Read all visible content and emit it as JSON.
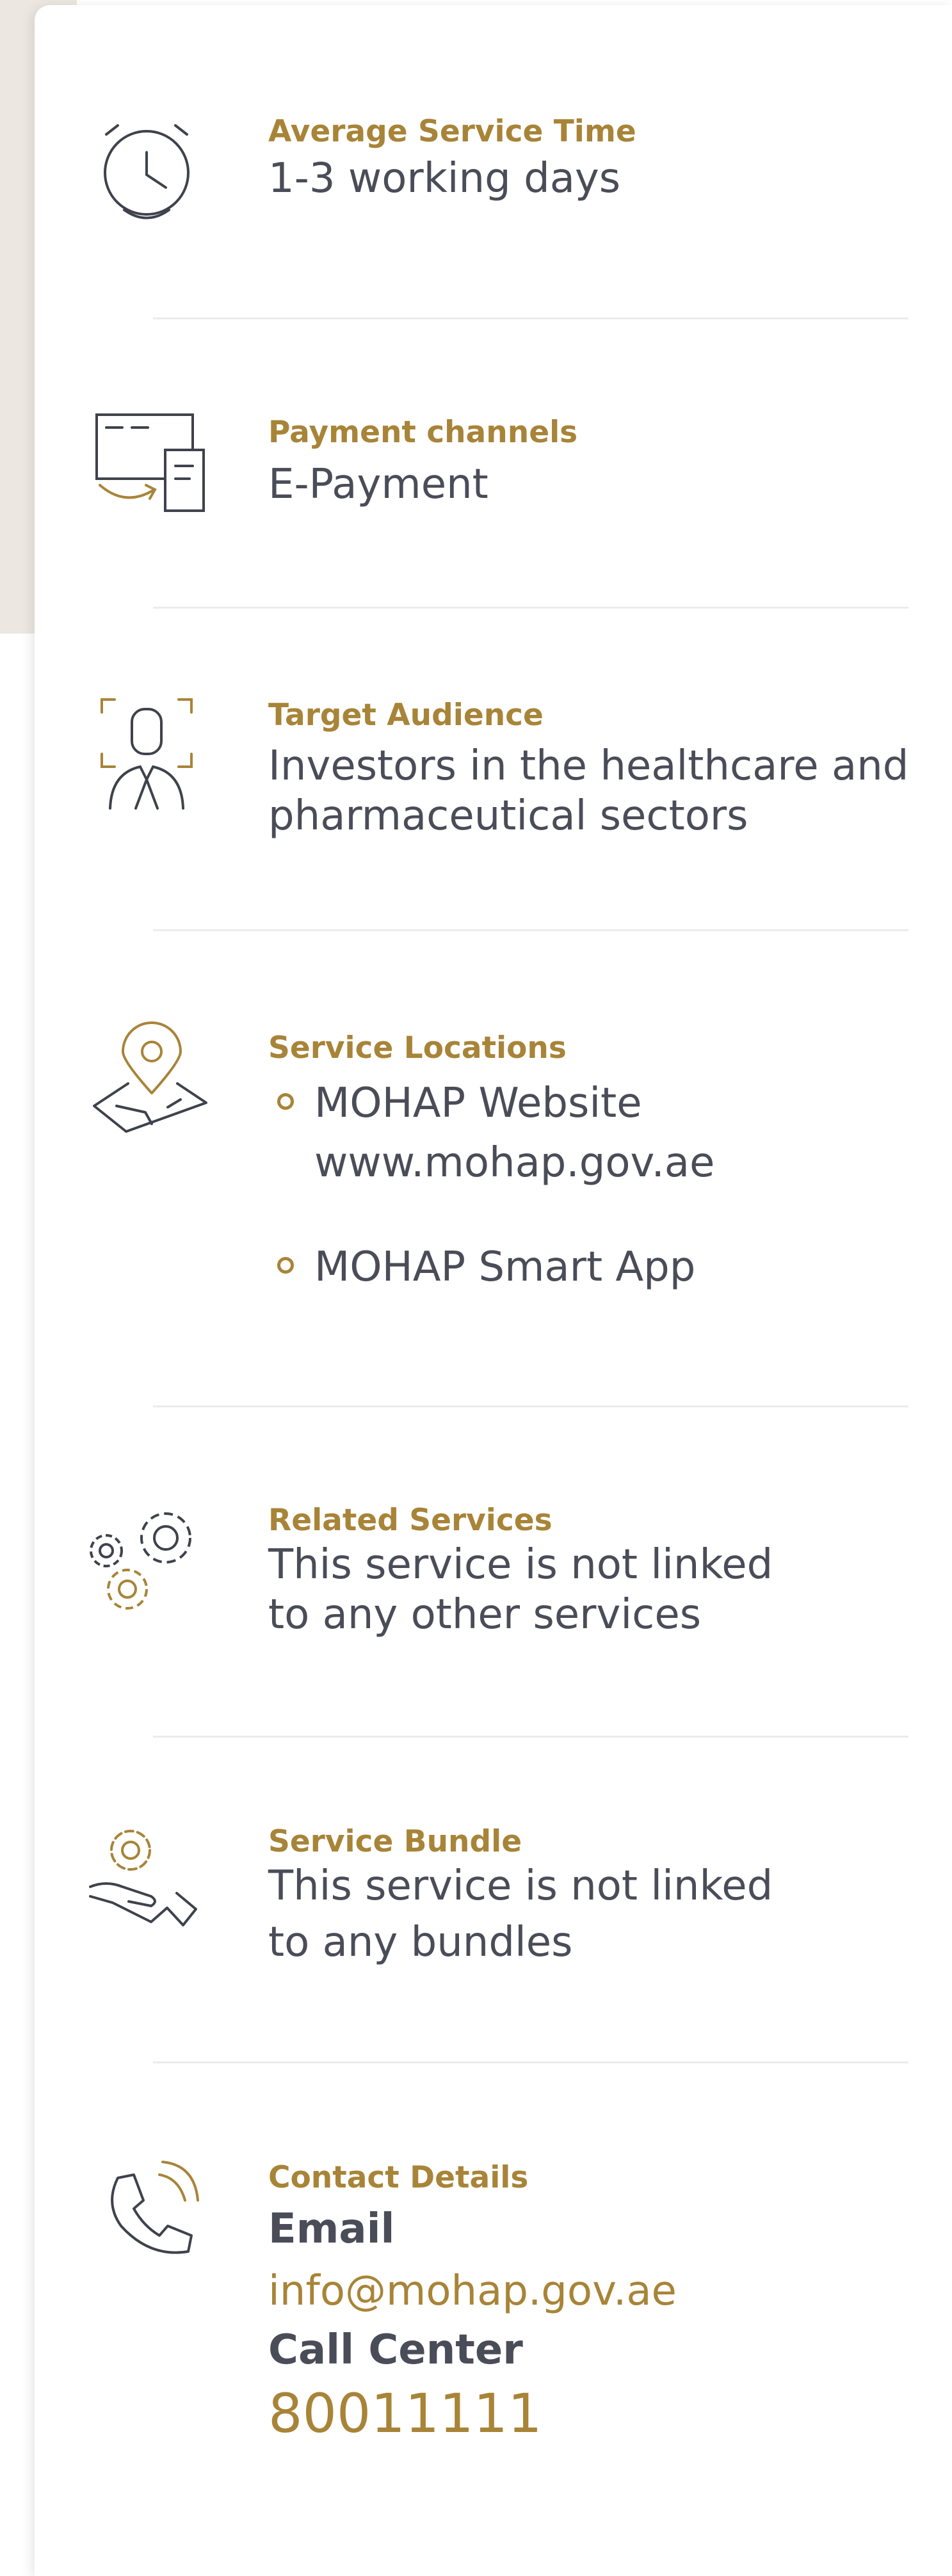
{
  "theme": {
    "gold": "#a88438",
    "text": "#4a4c58",
    "divider": "#ececec",
    "page_bg": "#ece7e1"
  },
  "average_service_time": {
    "label": "Average Service Time",
    "value": "1-3 working days",
    "icon": "alarm-clock-icon"
  },
  "payment_channels": {
    "label": "Payment channels",
    "value": "E-Payment",
    "icon": "payment-devices-icon"
  },
  "target_audience": {
    "label": "Target Audience",
    "value_line1": "Investors in the healthcare and",
    "value_line2": "pharmaceutical sectors",
    "icon": "person-focus-icon"
  },
  "service_locations": {
    "label": "Service Locations",
    "icon": "map-pin-icon",
    "items": [
      {
        "name": "MOHAP Website",
        "url": "www.mohap.gov.ae"
      },
      {
        "name": "MOHAP Smart App"
      }
    ]
  },
  "related_services": {
    "label": "Related Services",
    "value_line1": "This service is not linked",
    "value_line2": "to any other services",
    "icon": "gears-icon"
  },
  "service_bundle": {
    "label": "Service Bundle",
    "value_line1": "This service is not linked",
    "value_line2": "to any bundles",
    "icon": "hand-gear-icon"
  },
  "contact_details": {
    "label": "Contact Details",
    "icon": "phone-ringing-icon",
    "email_heading": "Email",
    "email": "info@mohap.gov.ae",
    "call_center_heading": "Call Center",
    "call_center_number": "80011111"
  }
}
